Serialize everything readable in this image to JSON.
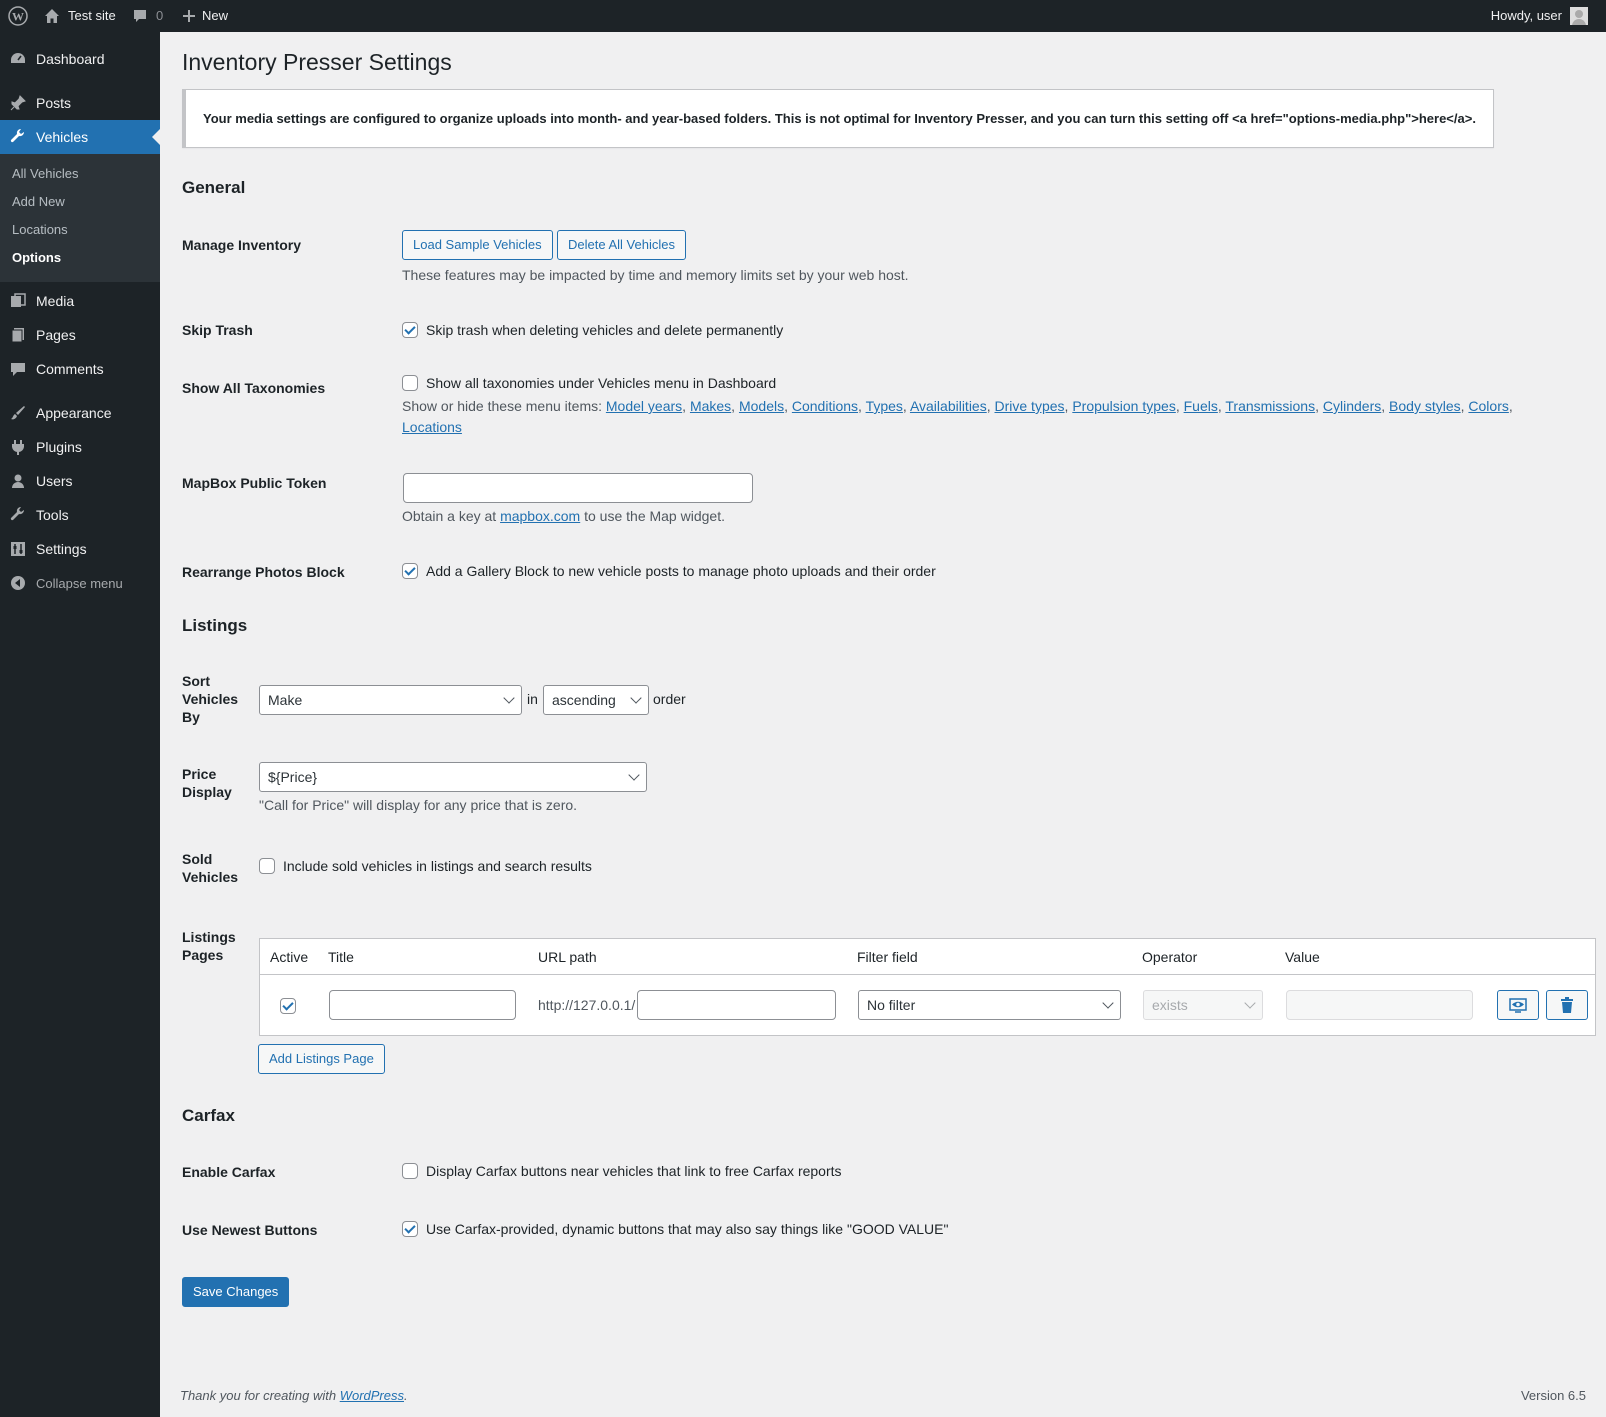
{
  "adminbar": {
    "site_name": "Test site",
    "comments_count": "0",
    "new_label": "New",
    "howdy": "Howdy, user"
  },
  "sidebar": {
    "items": [
      {
        "label": "Dashboard",
        "icon": "dashboard-icon"
      },
      {
        "label": "Posts",
        "icon": "pin-icon"
      },
      {
        "label": "Vehicles",
        "icon": "wrench-icon"
      },
      {
        "label": "Media",
        "icon": "media-icon"
      },
      {
        "label": "Pages",
        "icon": "pages-icon"
      },
      {
        "label": "Comments",
        "icon": "comment-icon"
      },
      {
        "label": "Appearance",
        "icon": "brush-icon"
      },
      {
        "label": "Plugins",
        "icon": "plug-icon"
      },
      {
        "label": "Users",
        "icon": "user-icon"
      },
      {
        "label": "Tools",
        "icon": "wrench-icon"
      },
      {
        "label": "Settings",
        "icon": "settings-icon"
      },
      {
        "label": "Collapse menu",
        "icon": "collapse-icon"
      }
    ],
    "submenu": [
      "All Vehicles",
      "Add New",
      "Locations",
      "Options"
    ]
  },
  "page": {
    "title": "Inventory Presser Settings",
    "notice": "Your media settings are configured to organize uploads into month- and year-based folders. This is not optimal for Inventory Presser, and you can turn this setting off <a href=\"options-media.php\">here</a>."
  },
  "general": {
    "heading": "General",
    "manage_inventory": {
      "label": "Manage Inventory",
      "load_button": "Load Sample Vehicles",
      "delete_button": "Delete All Vehicles",
      "description": "These features may be impacted by time and memory limits set by your web host."
    },
    "skip_trash": {
      "label": "Skip Trash",
      "checkbox_label": "Skip trash when deleting vehicles and delete permanently",
      "checked": true
    },
    "show_taxonomies": {
      "label": "Show All Taxonomies",
      "checkbox_label": "Show all taxonomies under Vehicles menu in Dashboard",
      "checked": false,
      "desc_prefix": "Show or hide these menu items:",
      "links": [
        "Model years",
        "Makes",
        "Models",
        "Conditions",
        "Types",
        "Availabilities",
        "Drive types",
        "Propulsion types",
        "Fuels",
        "Transmissions",
        "Cylinders",
        "Body styles",
        "Colors",
        "Locations"
      ]
    },
    "mapbox": {
      "label": "MapBox Public Token",
      "value": "",
      "desc_prefix": "Obtain a key at",
      "link": "mapbox.com",
      "desc_suffix": "to use the Map widget."
    },
    "rearrange": {
      "label": "Rearrange Photos Block",
      "checkbox_label": "Add a Gallery Block to new vehicle posts to manage photo uploads and their order",
      "checked": true
    }
  },
  "listings": {
    "heading": "Listings",
    "sort": {
      "label": "Sort Vehicles By",
      "field": "Make",
      "in": "in",
      "direction": "ascending",
      "order": "order"
    },
    "price": {
      "label": "Price Display",
      "value": "${Price}",
      "description": "\"Call for Price\" will display for any price that is zero."
    },
    "sold": {
      "label": "Sold Vehicles",
      "checkbox_label": "Include sold vehicles in listings and search results",
      "checked": false
    },
    "pages": {
      "label": "Listings Pages",
      "columns": [
        "Active",
        "Title",
        "URL path",
        "Filter field",
        "Operator",
        "Value"
      ],
      "row": {
        "active": true,
        "title": "",
        "url_prefix": "http://127.0.0.1/",
        "url_path": "",
        "filter": "No filter",
        "operator": "exists",
        "value": ""
      },
      "add_button": "Add Listings Page"
    }
  },
  "carfax": {
    "heading": "Carfax",
    "enable": {
      "label": "Enable Carfax",
      "checkbox_label": "Display Carfax buttons near vehicles that link to free Carfax reports",
      "checked": false
    },
    "newest": {
      "label": "Use Newest Buttons",
      "checkbox_label": "Use Carfax-provided, dynamic buttons that may also say things like \"GOOD VALUE\"",
      "checked": true
    }
  },
  "save_button": "Save Changes",
  "footer": {
    "thanks_prefix": "Thank you for creating with",
    "link": "WordPress",
    "thanks_suffix": ".",
    "version": "Version 6.5"
  },
  "colors": {
    "accent": "#2271b1",
    "sidebar_bg": "#1d2327",
    "page_bg": "#f0f0f1"
  }
}
